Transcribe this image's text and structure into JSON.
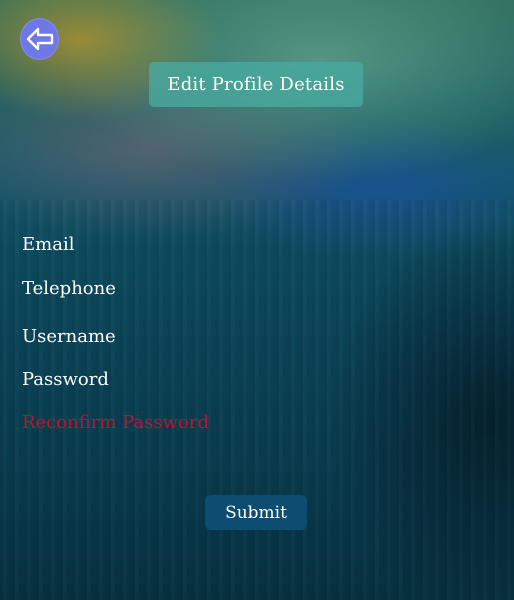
{
  "header": {
    "title": "Edit Profile Details",
    "back_icon": "back-arrow-icon"
  },
  "form": {
    "fields": [
      {
        "label": "Email"
      },
      {
        "label": "Telephone"
      },
      {
        "label": "Username"
      },
      {
        "label": "Password"
      },
      {
        "label": "Reconfirm Password",
        "state": "error"
      }
    ],
    "submit_label": "Submit"
  },
  "colors": {
    "back_button": "#6e78e8",
    "title_badge": "#48aaa0",
    "submit_button": "#0d4d72",
    "error_label": "#c8102e",
    "label_text": "#ffffff"
  }
}
